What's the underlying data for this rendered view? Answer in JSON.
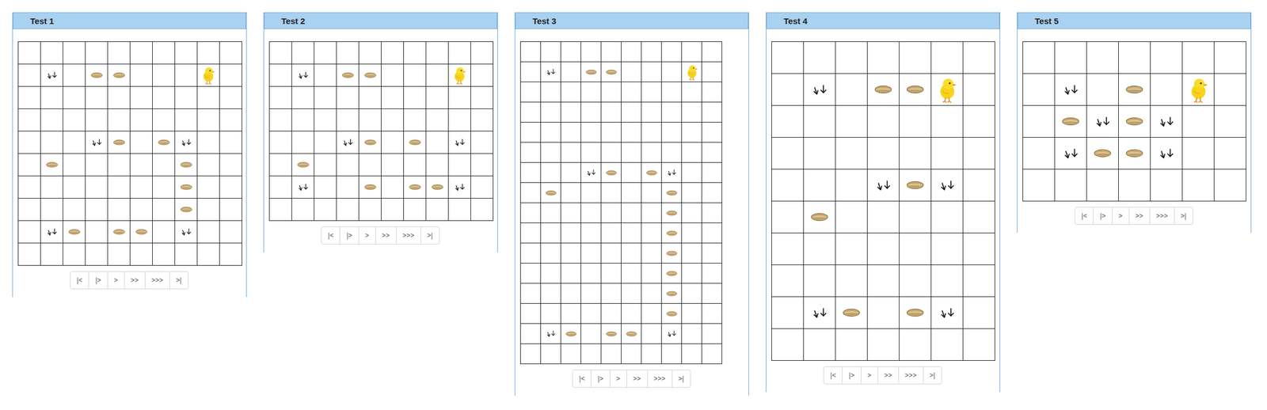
{
  "tests": [
    {
      "title": "Test 1",
      "cols": 10,
      "rows": 10,
      "controls": [
        "|<",
        "|>",
        ">",
        ">>",
        ">>>",
        ">|"
      ],
      "items": [
        {
          "kind": "arrows",
          "row": 1,
          "col": 1
        },
        {
          "kind": "seed",
          "row": 1,
          "col": 3
        },
        {
          "kind": "seed",
          "row": 1,
          "col": 4
        },
        {
          "kind": "chick",
          "row": 1,
          "col": 8
        },
        {
          "kind": "arrows",
          "row": 4,
          "col": 3
        },
        {
          "kind": "seed",
          "row": 4,
          "col": 4
        },
        {
          "kind": "seed",
          "row": 4,
          "col": 6
        },
        {
          "kind": "arrows",
          "row": 4,
          "col": 7
        },
        {
          "kind": "seed",
          "row": 5,
          "col": 1
        },
        {
          "kind": "seed",
          "row": 5,
          "col": 7
        },
        {
          "kind": "seed",
          "row": 6,
          "col": 7
        },
        {
          "kind": "seed",
          "row": 7,
          "col": 7
        },
        {
          "kind": "arrows",
          "row": 8,
          "col": 1
        },
        {
          "kind": "seed",
          "row": 8,
          "col": 2
        },
        {
          "kind": "seed",
          "row": 8,
          "col": 4
        },
        {
          "kind": "seed",
          "row": 8,
          "col": 5
        },
        {
          "kind": "arrows",
          "row": 8,
          "col": 7
        }
      ]
    },
    {
      "title": "Test 2",
      "cols": 10,
      "rows": 8,
      "controls": [
        "|<",
        "|>",
        ">",
        ">>",
        ">>>",
        ">|"
      ],
      "items": [
        {
          "kind": "arrows",
          "row": 1,
          "col": 1
        },
        {
          "kind": "seed",
          "row": 1,
          "col": 3
        },
        {
          "kind": "seed",
          "row": 1,
          "col": 4
        },
        {
          "kind": "chick",
          "row": 1,
          "col": 8
        },
        {
          "kind": "arrows",
          "row": 4,
          "col": 3
        },
        {
          "kind": "seed",
          "row": 4,
          "col": 4
        },
        {
          "kind": "seed",
          "row": 4,
          "col": 6
        },
        {
          "kind": "arrows",
          "row": 4,
          "col": 8
        },
        {
          "kind": "seed",
          "row": 5,
          "col": 1
        },
        {
          "kind": "arrows",
          "row": 6,
          "col": 1
        },
        {
          "kind": "seed",
          "row": 6,
          "col": 4
        },
        {
          "kind": "seed",
          "row": 6,
          "col": 6
        },
        {
          "kind": "seed",
          "row": 6,
          "col": 7
        },
        {
          "kind": "arrows",
          "row": 6,
          "col": 8
        }
      ]
    },
    {
      "title": "Test 3",
      "cols": 10,
      "rows": 16,
      "controls": [
        "|<",
        "|>",
        ">",
        ">>",
        ">>>",
        ">|"
      ],
      "items": [
        {
          "kind": "arrows",
          "row": 1,
          "col": 1
        },
        {
          "kind": "seed",
          "row": 1,
          "col": 3
        },
        {
          "kind": "seed",
          "row": 1,
          "col": 4
        },
        {
          "kind": "chick",
          "row": 1,
          "col": 8
        },
        {
          "kind": "arrows",
          "row": 6,
          "col": 3
        },
        {
          "kind": "seed",
          "row": 6,
          "col": 4
        },
        {
          "kind": "seed",
          "row": 6,
          "col": 6
        },
        {
          "kind": "arrows",
          "row": 6,
          "col": 7
        },
        {
          "kind": "seed",
          "row": 7,
          "col": 1
        },
        {
          "kind": "seed",
          "row": 7,
          "col": 7
        },
        {
          "kind": "seed",
          "row": 8,
          "col": 7
        },
        {
          "kind": "seed",
          "row": 9,
          "col": 7
        },
        {
          "kind": "seed",
          "row": 10,
          "col": 7
        },
        {
          "kind": "seed",
          "row": 11,
          "col": 7
        },
        {
          "kind": "seed",
          "row": 12,
          "col": 7
        },
        {
          "kind": "seed",
          "row": 13,
          "col": 7
        },
        {
          "kind": "arrows",
          "row": 14,
          "col": 1
        },
        {
          "kind": "seed",
          "row": 14,
          "col": 2
        },
        {
          "kind": "seed",
          "row": 14,
          "col": 4
        },
        {
          "kind": "seed",
          "row": 14,
          "col": 5
        },
        {
          "kind": "arrows",
          "row": 14,
          "col": 7
        }
      ]
    },
    {
      "title": "Test 4",
      "cols": 7,
      "rows": 10,
      "controls": [
        "|<",
        "|>",
        ">",
        ">>",
        ">>>",
        ">|"
      ],
      "items": [
        {
          "kind": "arrows",
          "row": 1,
          "col": 1
        },
        {
          "kind": "seed",
          "row": 1,
          "col": 3
        },
        {
          "kind": "seed",
          "row": 1,
          "col": 4
        },
        {
          "kind": "chick",
          "row": 1,
          "col": 5
        },
        {
          "kind": "arrows",
          "row": 4,
          "col": 3
        },
        {
          "kind": "seed",
          "row": 4,
          "col": 4
        },
        {
          "kind": "arrows",
          "row": 4,
          "col": 5
        },
        {
          "kind": "seed",
          "row": 5,
          "col": 1
        },
        {
          "kind": "arrows",
          "row": 8,
          "col": 1
        },
        {
          "kind": "seed",
          "row": 8,
          "col": 2
        },
        {
          "kind": "seed",
          "row": 8,
          "col": 4
        },
        {
          "kind": "arrows",
          "row": 8,
          "col": 5
        }
      ]
    },
    {
      "title": "Test 5",
      "cols": 7,
      "rows": 5,
      "controls": [
        "|<",
        "|>",
        ">",
        ">>",
        ">>>",
        ">|"
      ],
      "items": [
        {
          "kind": "arrows",
          "row": 1,
          "col": 1
        },
        {
          "kind": "seed",
          "row": 1,
          "col": 3
        },
        {
          "kind": "chick",
          "row": 1,
          "col": 5
        },
        {
          "kind": "seed",
          "row": 2,
          "col": 1
        },
        {
          "kind": "arrows",
          "row": 2,
          "col": 2
        },
        {
          "kind": "seed",
          "row": 2,
          "col": 3
        },
        {
          "kind": "arrows",
          "row": 2,
          "col": 4
        },
        {
          "kind": "arrows",
          "row": 3,
          "col": 1
        },
        {
          "kind": "seed",
          "row": 3,
          "col": 2
        },
        {
          "kind": "seed",
          "row": 3,
          "col": 3
        },
        {
          "kind": "arrows",
          "row": 3,
          "col": 4
        }
      ]
    }
  ]
}
